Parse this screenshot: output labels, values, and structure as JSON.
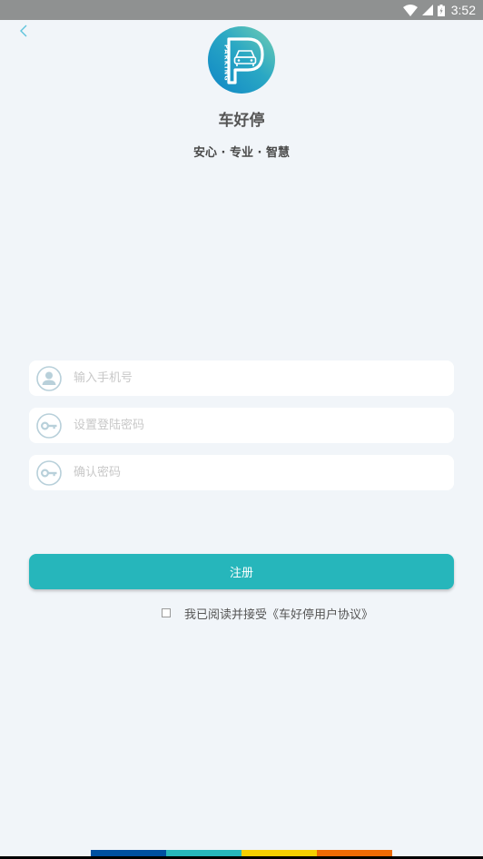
{
  "status_bar": {
    "time": "3:52",
    "icons": [
      "wifi-icon",
      "cellular-signal-icon",
      "battery-charging-icon"
    ]
  },
  "nav": {
    "back_icon": "chevron-left-icon"
  },
  "brand": {
    "logo_text": "PARKING",
    "app_name": "车好停",
    "slogan": "安心 · 专业 · 智慧",
    "logo_gradient": [
      "#1a8fc4",
      "#5fc4b4"
    ]
  },
  "form": {
    "phone": {
      "icon": "user-icon",
      "value": "",
      "placeholder": "输入手机号"
    },
    "password": {
      "icon": "key-icon",
      "value": "",
      "placeholder": "设置登陆密码"
    },
    "confirm_password": {
      "icon": "key-icon",
      "value": "",
      "placeholder": "确认密码"
    },
    "submit_label": "注册",
    "agreement": {
      "checked": false,
      "prefix": "我已阅读并接受",
      "link": "《车好停用户协议》"
    }
  },
  "colors": {
    "accent": "#26b6bb",
    "background": "#f1f5f9",
    "icon_tint": "#b8d0da"
  },
  "footer_strip": {
    "colors": [
      "#0050a0",
      "#27b7bb",
      "#f5cf00",
      "#ef6a05"
    ]
  }
}
